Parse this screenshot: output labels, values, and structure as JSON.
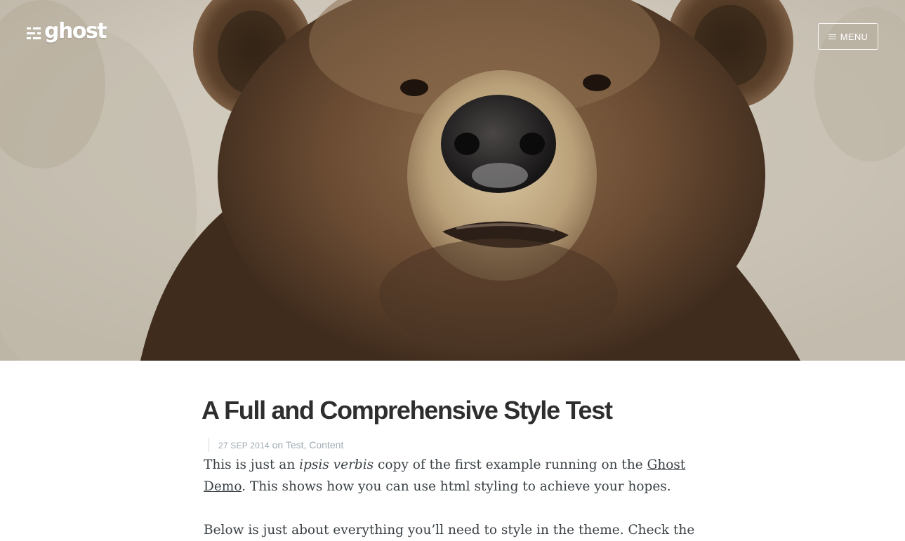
{
  "site": {
    "logo_text": "ghost",
    "menu_label": "MENU"
  },
  "hero": {
    "image": "bear-cover-photo",
    "colors": {
      "fur_dark": "#4a3424",
      "fur_mid": "#7a5a3e",
      "muzzle": "#c9b48e",
      "nose": "#2b2a2a",
      "background": "#d9d3c8"
    }
  },
  "post": {
    "title": "A Full and Comprehensive Style Test",
    "meta": {
      "date": "27 Sep 2014",
      "on": "on",
      "tags": [
        "Test",
        "Content"
      ],
      "separator": ", "
    },
    "paragraph1": {
      "before_em": "This is just an ",
      "em": "ipsis verbis",
      "mid": " copy of the first example running on the ",
      "link1": "Ghost",
      "link2": "Demo",
      "after": ". This shows how you can use html styling to achieve your hopes."
    },
    "paragraph2": {
      "text": "Below is just about everything you’ll need to style in the theme. Check the"
    }
  }
}
